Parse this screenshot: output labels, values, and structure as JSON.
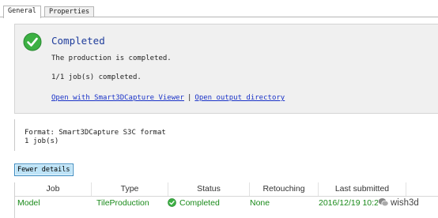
{
  "tabs": [
    {
      "label": "General"
    },
    {
      "label": "Properties"
    }
  ],
  "status": {
    "title": "Completed",
    "message": "The production is completed.",
    "jobs_line": "1/1 job(s) completed.",
    "link_viewer": "Open with Smart3DCapture Viewer",
    "link_sep": "|",
    "link_output": "Open output directory"
  },
  "format": {
    "line1": "Format: Smart3DCapture S3C format",
    "line2": "1 job(s)"
  },
  "fewer_details_label": "Fewer details",
  "table": {
    "headers": [
      "Job",
      "Type",
      "Status",
      "Retouching",
      "Last submitted"
    ],
    "rows": [
      {
        "job": "Model",
        "type": "TileProduction",
        "status": "Completed",
        "retouching": "None",
        "last_submitted": "2016/12/19 10:2"
      }
    ]
  },
  "watermark": "wish3d",
  "colors": {
    "status_green": "#1a8a1a",
    "title_blue": "#1f3d9c",
    "link_blue": "#1a33c8",
    "check_green": "#3cb043"
  }
}
